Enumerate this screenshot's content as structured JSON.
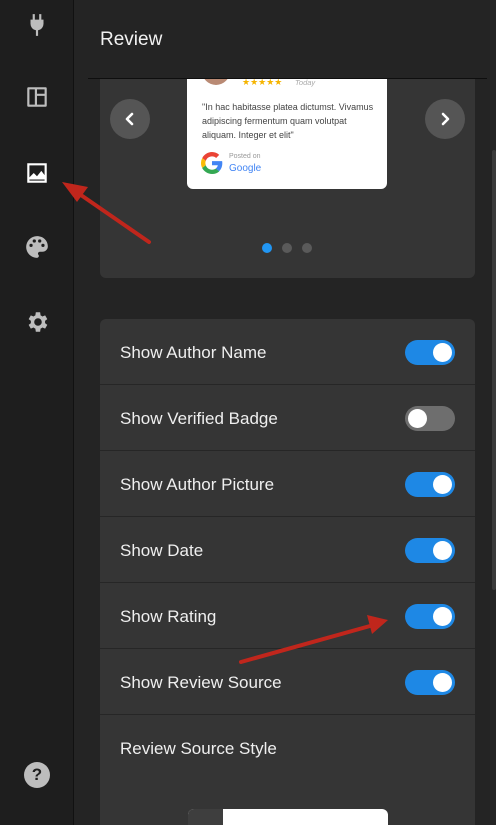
{
  "header": {
    "title": "Review"
  },
  "rail": {
    "items": [
      {
        "name": "plug-icon"
      },
      {
        "name": "layout-icon"
      },
      {
        "name": "image-icon",
        "active": true
      },
      {
        "name": "palette-icon"
      },
      {
        "name": "gear-icon"
      }
    ],
    "help_label": "?"
  },
  "preview": {
    "card": {
      "stars": "★★★★★",
      "date": "Today",
      "text": "\"In hac habitasse platea dictumst. Vivamus adipiscing fermentum quam volutpat aliquam. Integer et elit\"",
      "posted_on": "Posted on",
      "source": "Google"
    },
    "dots": {
      "count": 3,
      "active_index": 0
    }
  },
  "settings": {
    "rows": [
      {
        "label": "Show Author Name",
        "on": true
      },
      {
        "label": "Show Verified Badge",
        "on": false
      },
      {
        "label": "Show Author Picture",
        "on": true
      },
      {
        "label": "Show Date",
        "on": true
      },
      {
        "label": "Show Rating",
        "on": true
      },
      {
        "label": "Show Review Source",
        "on": true
      }
    ],
    "source_style_label": "Review Source Style"
  },
  "colors": {
    "accent": "#1e88e5",
    "annotation": "#c0261c",
    "star": "#f5b400"
  }
}
